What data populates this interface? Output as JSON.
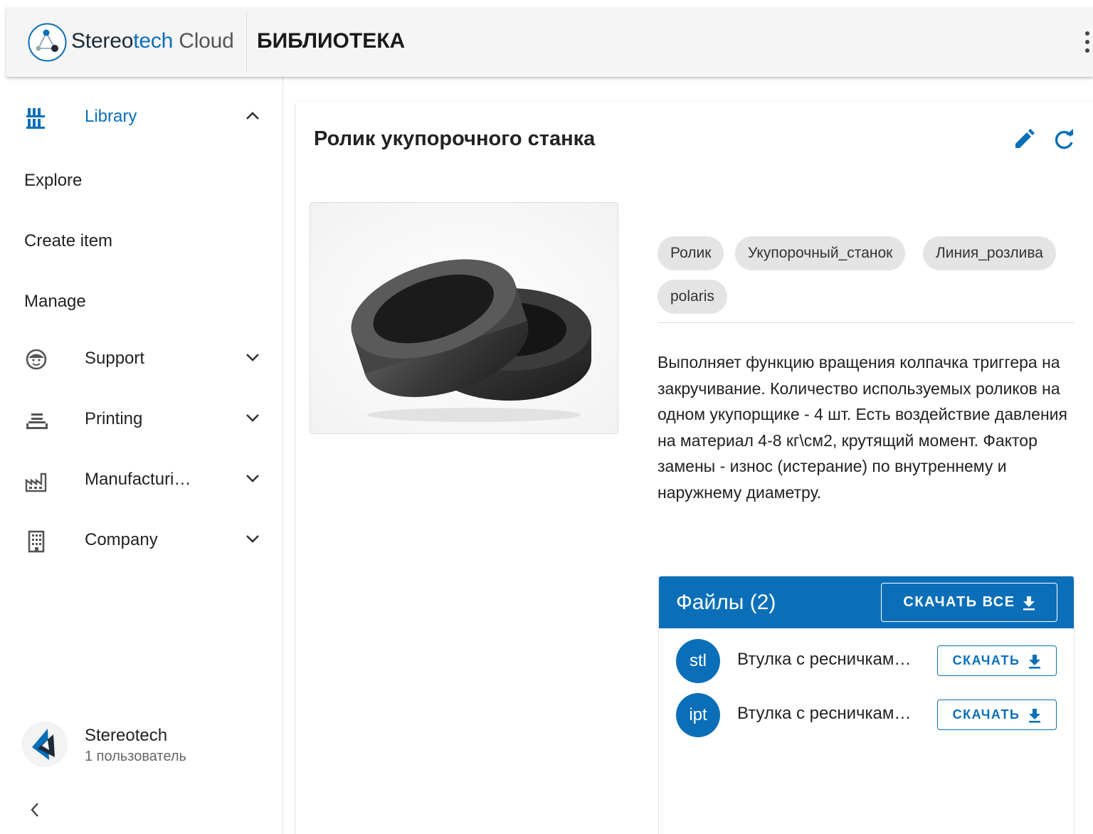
{
  "header": {
    "brand": {
      "part1": "Stereo",
      "part2": "tech",
      "part3": " Cloud"
    },
    "page_heading": "БИБЛИОТЕКА",
    "menu_icon": "more-vert-icon"
  },
  "sidebar": {
    "library": {
      "label": "Library",
      "icon": "library-icon",
      "expanded": true
    },
    "sub_items": [
      {
        "label": "Explore"
      },
      {
        "label": "Create item"
      },
      {
        "label": "Manage"
      }
    ],
    "groups": [
      {
        "label": "Support",
        "icon": "support-icon"
      },
      {
        "label": "Printing",
        "icon": "printer-icon"
      },
      {
        "label": "Manufacturi…",
        "icon": "factory-icon"
      },
      {
        "label": "Company",
        "icon": "building-icon"
      }
    ],
    "org": {
      "name": "Stereotech",
      "users": "1 пользователь"
    }
  },
  "item": {
    "title": "Ролик укупорочного станка",
    "tags": [
      "Ролик",
      "Укупорочный_станок",
      "Линия_розлива",
      "polaris"
    ],
    "description": "Выполняет функцию вращения колпачка триггера на закручивание. Количество используемых роликов на одном укупорщике - 4 шт. Есть воздействие давления на материал 4-8 кг\\см2, крутящий момент. Фактор замены - износ (истерание) по внутреннему и наружнему диаметру."
  },
  "files": {
    "title": "Файлы (2)",
    "download_all_label": "СКАЧАТЬ ВСЕ",
    "items": [
      {
        "ext": "stl",
        "name": "Втулка с ресничкам…",
        "download_label": "СКАЧАТЬ"
      },
      {
        "ext": "ipt",
        "name": "Втулка с ресничкам…",
        "download_label": "СКАЧАТЬ"
      }
    ]
  },
  "colors": {
    "accent": "#0a6fb8",
    "chip_bg": "#e4e4e4",
    "header_bg": "#f5f5f5"
  }
}
